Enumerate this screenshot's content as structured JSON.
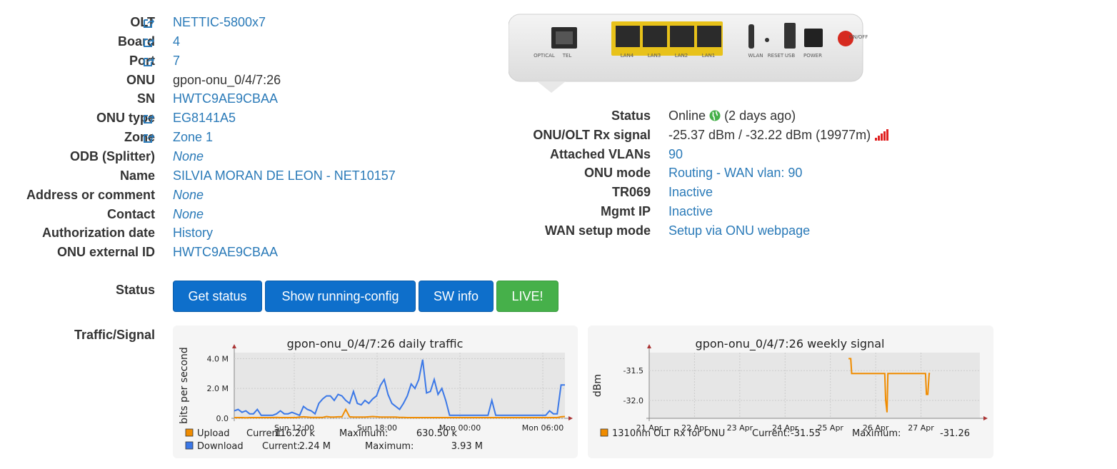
{
  "left_fields": [
    {
      "label": "OLT",
      "value": "NETTIC-5800x7",
      "style": "link",
      "ext": true
    },
    {
      "label": "Board",
      "value": "4",
      "style": "link",
      "ext": true
    },
    {
      "label": "Port",
      "value": "7",
      "style": "link",
      "ext": true
    },
    {
      "label": "ONU",
      "value": "gpon-onu_0/4/7:26",
      "style": "plain",
      "ext": false
    },
    {
      "label": "SN",
      "value": "HWTC9AE9CBAA",
      "style": "link",
      "ext": false
    },
    {
      "label": "ONU type",
      "value": "EG8141A5",
      "style": "link",
      "ext": true
    },
    {
      "label": "Zone",
      "value": "Zone 1",
      "style": "link",
      "ext": true
    },
    {
      "label": "ODB (Splitter)",
      "value": "None",
      "style": "italic",
      "ext": false
    },
    {
      "label": "Name",
      "value": "SILVIA MORAN DE LEON - NET10157",
      "style": "link",
      "ext": false
    },
    {
      "label": "Address or comment",
      "value": "None",
      "style": "italic",
      "ext": false
    },
    {
      "label": "Contact",
      "value": "None",
      "style": "italic",
      "ext": false
    },
    {
      "label": "Authorization date",
      "value": "History",
      "style": "link",
      "ext": false
    },
    {
      "label": "ONU external ID",
      "value": "HWTC9AE9CBAA",
      "style": "link",
      "ext": false
    }
  ],
  "right_fields": [
    {
      "label": "Status",
      "value": "Online",
      "suffix": "(2 days ago)",
      "style": "plain"
    },
    {
      "label": "ONU/OLT Rx signal",
      "value": "-25.37 dBm / -32.22 dBm (19977m)",
      "style": "plain"
    },
    {
      "label": "Attached VLANs",
      "value": "90",
      "style": "link"
    },
    {
      "label": "ONU mode",
      "value": "Routing - WAN vlan: 90",
      "style": "link"
    },
    {
      "label": "TR069",
      "value": "Inactive",
      "style": "link"
    },
    {
      "label": "Mgmt IP",
      "value": "Inactive",
      "style": "link"
    },
    {
      "label": "WAN setup mode",
      "value": "Setup via ONU webpage",
      "style": "link"
    }
  ],
  "device_image": {
    "port_labels": [
      "OPTICAL",
      "TEL",
      "LAN4",
      "LAN3",
      "LAN2",
      "LAN1",
      "WLAN",
      "RESET",
      "USB",
      "POWER",
      "ON/OFF"
    ]
  },
  "status_section": {
    "label": "Status",
    "buttons": [
      {
        "label": "Get status",
        "color": "#0e6fcb"
      },
      {
        "label": "Show running-config",
        "color": "#0e6fcb"
      },
      {
        "label": "SW info",
        "color": "#0e6fcb"
      },
      {
        "label": "LIVE!",
        "color": "#46b04a"
      }
    ]
  },
  "traffic_label": "Traffic/Signal",
  "chart_data": [
    {
      "type": "line",
      "title": "gpon-onu_0/4/7:26 daily traffic",
      "ylabel": "bits per second",
      "xlabel": "",
      "x_ticks": [
        "Sun 12:00",
        "Sun 18:00",
        "Mon 00:00",
        "Mon 06:00"
      ],
      "y_ticks": [
        "0.0",
        "2.0 M",
        "4.0 M"
      ],
      "ylim": [
        0,
        4400000
      ],
      "series": [
        {
          "name": "Upload",
          "color": "#f08c00",
          "current": "116.20 k",
          "maximum": "630.50 k",
          "values": [
            0.05,
            0.05,
            0.05,
            0.04,
            0.05,
            0.05,
            0.05,
            0.05,
            0.05,
            0.05,
            0.05,
            0.06,
            0.05,
            0.05,
            0.05,
            0.05,
            0.05,
            0.08,
            0.1,
            0.08,
            0.06,
            0.06,
            0.06,
            0.06,
            0.12,
            0.08,
            0.08,
            0.1,
            0.1,
            0.6,
            0.1,
            0.08,
            0.08,
            0.08,
            0.08,
            0.1,
            0.12,
            0.1,
            0.08,
            0.08,
            0.08,
            0.08,
            0.08,
            0.06,
            0.06,
            0.05,
            0.05,
            0.05,
            0.05,
            0.05,
            0.05,
            0.05,
            0.05,
            0.05,
            0.05,
            0.05,
            0.05,
            0.05,
            0.05,
            0.05,
            0.05,
            0.05,
            0.05,
            0.05,
            0.05,
            0.05,
            0.05,
            0.05,
            0.05,
            0.05,
            0.05,
            0.05,
            0.05,
            0.05,
            0.05,
            0.05,
            0.05,
            0.05,
            0.05,
            0.05,
            0.05,
            0.05,
            0.05,
            0.05,
            0.05,
            0.1,
            0.12
          ]
        },
        {
          "name": "Download",
          "color": "#3b78e7",
          "current": "2.24 M",
          "maximum": "3.93 M",
          "values": [
            0.5,
            0.6,
            0.4,
            0.5,
            0.3,
            0.3,
            0.6,
            0.2,
            0.2,
            0.2,
            0.2,
            0.3,
            0.5,
            0.3,
            0.3,
            0.4,
            0.3,
            0.2,
            0.8,
            0.6,
            0.5,
            0.3,
            1.0,
            1.3,
            1.5,
            1.5,
            1.2,
            1.6,
            1.5,
            1.2,
            1.0,
            1.8,
            1.0,
            0.9,
            1.2,
            1.0,
            1.3,
            1.5,
            2.2,
            2.6,
            1.6,
            1.0,
            0.8,
            0.6,
            1.0,
            1.5,
            2.3,
            2.0,
            2.6,
            3.93,
            1.7,
            1.8,
            2.6,
            1.6,
            2.0,
            1.2,
            0.2,
            0.2,
            0.2,
            0.2,
            0.2,
            0.2,
            0.2,
            0.2,
            0.2,
            0.2,
            0.2,
            1.2,
            0.2,
            0.2,
            0.2,
            0.2,
            0.2,
            0.2,
            0.2,
            0.2,
            0.2,
            0.2,
            0.2,
            0.2,
            0.2,
            0.2,
            0.5,
            0.3,
            0.3,
            2.24,
            2.24
          ]
        }
      ]
    },
    {
      "type": "line",
      "title": "gpon-onu_0/4/7:26 weekly signal",
      "ylabel": "dBm",
      "xlabel": "",
      "x_ticks": [
        "21 Apr",
        "22 Apr",
        "23 Apr",
        "24 Apr",
        "25 Apr",
        "26 Apr",
        "27 Apr"
      ],
      "y_ticks": [
        "-31.5",
        "-32.0"
      ],
      "ylim": [
        -32.3,
        -31.2
      ],
      "series": [
        {
          "name": "1310nm OLT Rx for ONU",
          "color": "#f08c00",
          "current": "-31.55",
          "maximum": "-31.26",
          "x": [
            4.4,
            4.45,
            4.47,
            5.2,
            5.22,
            5.25,
            5.27,
            5.32,
            5.35,
            6.1,
            6.12,
            6.15,
            6.18,
            6.2
          ],
          "values": [
            -31.3,
            -31.3,
            -31.55,
            -31.55,
            -32.0,
            -32.2,
            -31.55,
            -31.55,
            -31.55,
            -31.55,
            -31.9,
            -31.9,
            -31.55,
            -31.55
          ]
        }
      ]
    }
  ]
}
